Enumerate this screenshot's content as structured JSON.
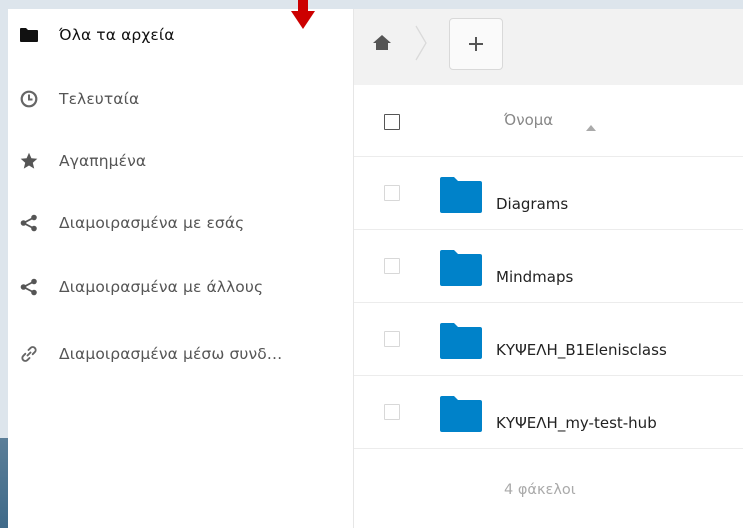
{
  "sidebar": {
    "items": [
      {
        "label": "Όλα τα αρχεία",
        "icon": "folder-icon",
        "active": true
      },
      {
        "label": "Τελευταία",
        "icon": "clock-icon"
      },
      {
        "label": "Αγαπημένα",
        "icon": "star-icon"
      },
      {
        "label": "Διαμοιρασμένα με εσάς",
        "icon": "share-icon"
      },
      {
        "label": "Διαμοιρασμένα με άλλους",
        "icon": "share-icon"
      },
      {
        "label": "Διαμοιρασμένα μέσω συνδ…",
        "icon": "link-icon"
      }
    ]
  },
  "toolbar": {
    "home_icon": "home-icon",
    "new_label": "+"
  },
  "file_list": {
    "column_name": "Όνομα",
    "sort_direction": "ascending",
    "rows": [
      {
        "name": "Diagrams",
        "type": "folder"
      },
      {
        "name": "Mindmaps",
        "type": "folder"
      },
      {
        "name": "ΚΥΨΕΛΗ_B1Elenisclass",
        "type": "folder"
      },
      {
        "name": "ΚΥΨΕΛΗ_my-test-hub",
        "type": "folder"
      }
    ],
    "summary": "4 φάκελοι"
  },
  "colors": {
    "folder": "#0082c9",
    "indicator": "#cc0000",
    "toolbar_bg": "#f2f2f2"
  }
}
